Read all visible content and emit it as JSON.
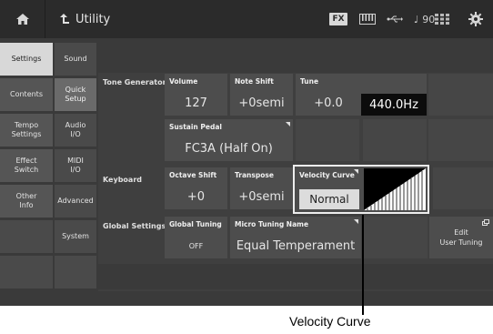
{
  "topbar": {
    "home_icon": "home-icon",
    "back_icon": "back-arrow-icon",
    "title": "Utility",
    "fx_badge": "FX",
    "keyboard_icon": "keyboard-icon",
    "usb_icon": "usb-icon",
    "tempo_note": "♩",
    "tempo_value": "90",
    "grid_icon": "grid-icon",
    "gear_icon": "gear-icon"
  },
  "sidebar": {
    "col1": [
      {
        "label": "Settings",
        "active": true
      },
      {
        "label": "Contents",
        "active": false
      },
      {
        "label": "Tempo\nSettings",
        "active": false
      },
      {
        "label": "Effect\nSwitch",
        "active": false
      },
      {
        "label": "Other\nInfo",
        "active": false
      }
    ],
    "col2": [
      {
        "label": "Sound"
      },
      {
        "label": "Quick\nSetup"
      },
      {
        "label": "Audio\nI/O"
      },
      {
        "label": "MIDI\nI/O"
      },
      {
        "label": "Advanced"
      },
      {
        "label": "System"
      }
    ]
  },
  "sections": {
    "tone_generator": "Tone Generator",
    "keyboard": "Keyboard",
    "global_settings": "Global Settings"
  },
  "params": {
    "volume": {
      "label": "Volume",
      "value": "127"
    },
    "note_shift": {
      "label": "Note Shift",
      "value": "+0semi"
    },
    "tune": {
      "label": "Tune",
      "value": "+0.0",
      "hz": "440.0Hz"
    },
    "sustain_pedal": {
      "label": "Sustain Pedal",
      "value": "FC3A (Half On)"
    },
    "octave_shift": {
      "label": "Octave Shift",
      "value": "+0"
    },
    "transpose": {
      "label": "Transpose",
      "value": "+0semi"
    },
    "velocity_curve": {
      "label": "Velocity Curve",
      "value": "Normal"
    },
    "global_tuning": {
      "label": "Global Tuning",
      "value": "OFF"
    },
    "micro_tuning_name": {
      "label": "Micro Tuning Name",
      "value": "Equal Temperament"
    },
    "edit_user_tuning": {
      "label": "Edit\nUser Tuning"
    }
  },
  "callout": {
    "text": "Velocity Curve"
  }
}
